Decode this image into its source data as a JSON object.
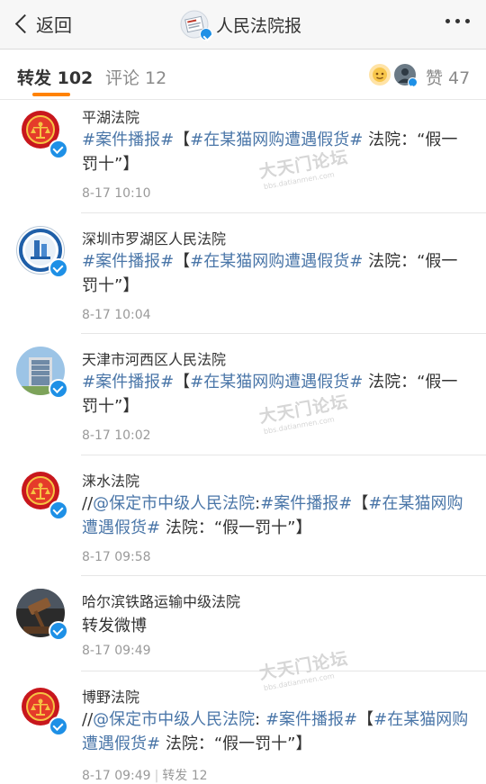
{
  "nav": {
    "back_label": "返回",
    "title": "人民法院报",
    "more_icon": "more-dots-icon"
  },
  "tabs": {
    "reposts": "转发 102",
    "comments": "评论 12",
    "likes": "赞 47"
  },
  "colors": {
    "accent": "#ff8200",
    "link": "#4a76a8",
    "verified": "#1e90e6"
  },
  "watermark": {
    "text": "大天门论坛",
    "url": "bbs.datianmen.com"
  },
  "items": [
    {
      "name": "平湖法院",
      "avatar": "court-emblem-icon",
      "segments": [
        "#案件播报#",
        "【",
        "#在某猫网购遭遇假货#",
        " 法院：“假一罚十”】"
      ],
      "time": "8-17 10:10"
    },
    {
      "name": "深圳市罗湖区人民法院",
      "avatar": "court-seal-icon",
      "segments": [
        "#案件播报#",
        "【",
        "#在某猫网购遭遇假货#",
        " 法院：“假一罚十”】"
      ],
      "time": "8-17 10:04"
    },
    {
      "name": "天津市河西区人民法院",
      "avatar": "court-building-icon",
      "segments": [
        "#案件播报#",
        "【",
        "#在某猫网购遭遇假货#",
        " 法院：“假一罚十”】"
      ],
      "time": "8-17 10:02"
    },
    {
      "name": "涞水法院",
      "avatar": "court-emblem-icon",
      "segments": [
        "//",
        "@保定市中级人民法院",
        ":",
        "#案件播报#",
        "【",
        "#在某猫网购遭遇假货#",
        " 法院：“假一罚十”】"
      ],
      "time": "8-17 09:58"
    },
    {
      "name": "哈尔滨铁路运输中级法院",
      "avatar": "gavel-icon",
      "text": "转发微博",
      "time": "8-17 09:49"
    },
    {
      "name": "博野法院",
      "avatar": "court-emblem-icon",
      "segments": [
        "//",
        "@保定市中级人民法院",
        ": ",
        "#案件播报#",
        "【",
        "#在某猫网购遭遇假货#",
        " 法院：“假一罚十”】"
      ],
      "time": "8-17 09:49",
      "repost_label": "转发 12"
    }
  ]
}
